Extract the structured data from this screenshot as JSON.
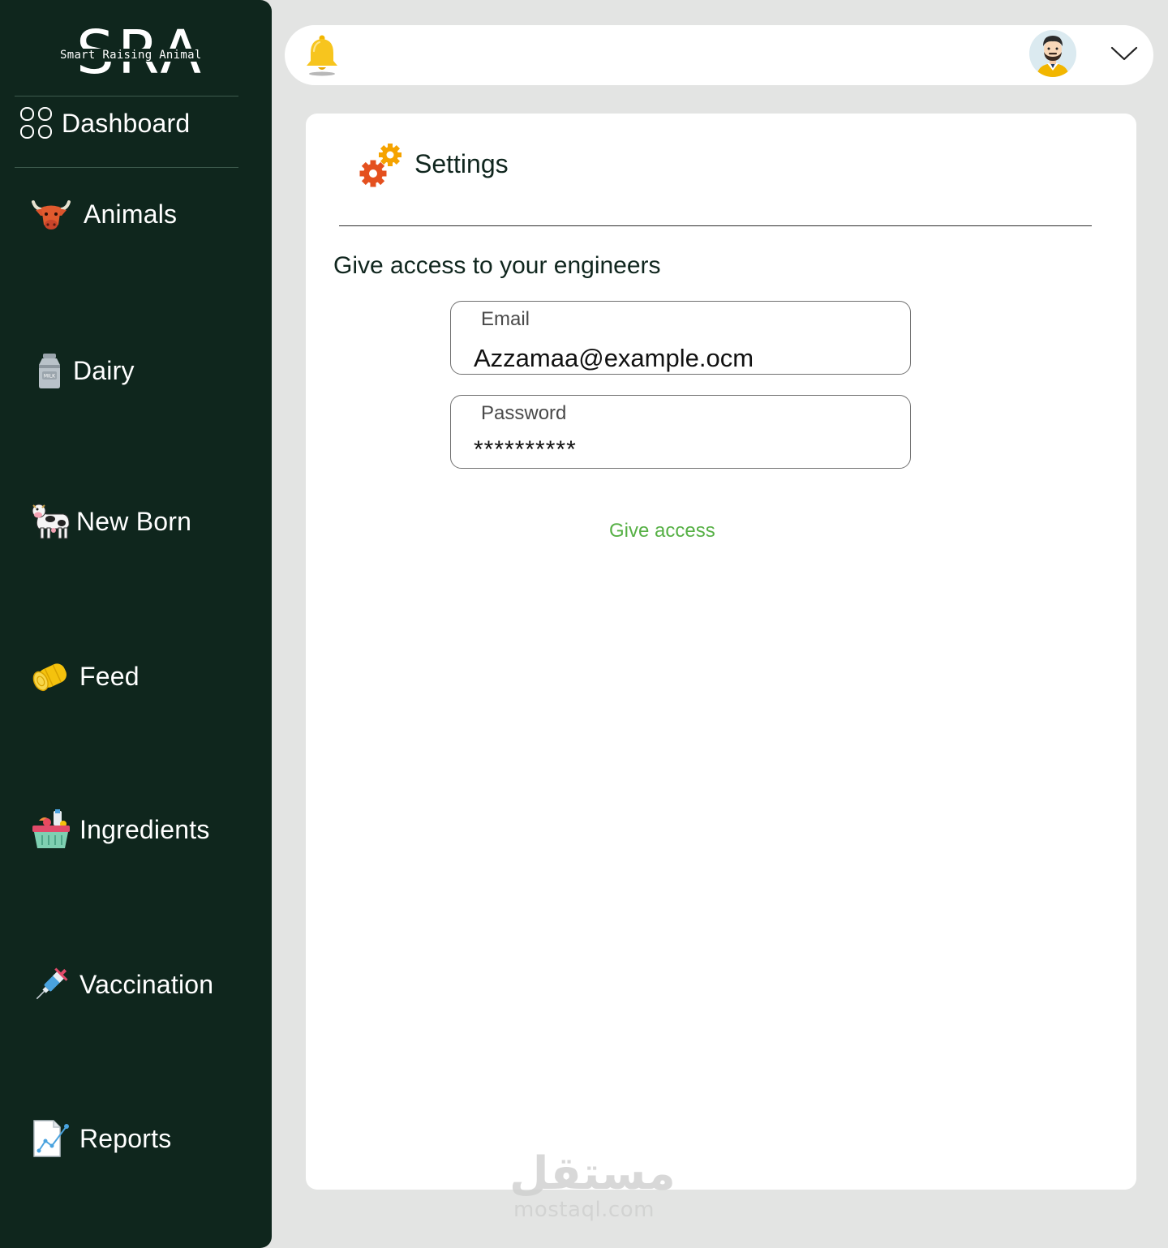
{
  "brand": {
    "mark": "SRA",
    "tagline": "Smart Raising Animal"
  },
  "sidebar": {
    "items": [
      {
        "label": "Dashboard",
        "icon": "grid-icon"
      },
      {
        "label": "Animals",
        "icon": "bull-head-icon"
      },
      {
        "label": "Dairy",
        "icon": "milk-can-icon"
      },
      {
        "label": "New Born",
        "icon": "cow-icon"
      },
      {
        "label": "Feed",
        "icon": "hay-bale-icon"
      },
      {
        "label": "Ingredients",
        "icon": "grocery-basket-icon"
      },
      {
        "label": "Vaccination",
        "icon": "syringe-icon"
      },
      {
        "label": "Reports",
        "icon": "report-chart-icon"
      }
    ]
  },
  "topbar": {
    "notification_icon": "bell-icon",
    "avatar_icon": "user-avatar-icon",
    "menu_icon": "chevron-down-icon"
  },
  "main": {
    "title": "Settings",
    "title_icon": "gears-icon",
    "section_title": "Give access to your engineers",
    "email": {
      "label": "Email",
      "value": "Azzamaa@example.ocm"
    },
    "password": {
      "label": "Password",
      "value": "**********"
    },
    "submit_label": "Give access"
  },
  "watermark": {
    "arabic": "مستقل",
    "url": "mostaql.com"
  },
  "colors": {
    "sidebar_bg": "#0f261d",
    "page_bg": "#e3e4e3",
    "accent_green": "#56b045",
    "text_dark": "#10261e"
  }
}
